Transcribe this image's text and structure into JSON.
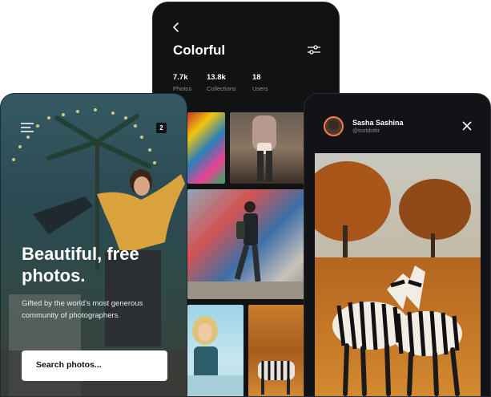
{
  "middle": {
    "title": "Colorful",
    "stats": [
      {
        "value": "7.7k",
        "label": "Photos"
      },
      {
        "value": "13.8k",
        "label": "Collections"
      },
      {
        "value": "18",
        "label": "Users"
      }
    ]
  },
  "left": {
    "badge": "2",
    "headline": "Beautiful, free photos.",
    "subtitle": "Gifted by the world’s most generous community of photographers.",
    "search_placeholder": "Search photos..."
  },
  "right": {
    "user_name": "Sasha Sashina",
    "user_handle": "@tsotdottir"
  }
}
